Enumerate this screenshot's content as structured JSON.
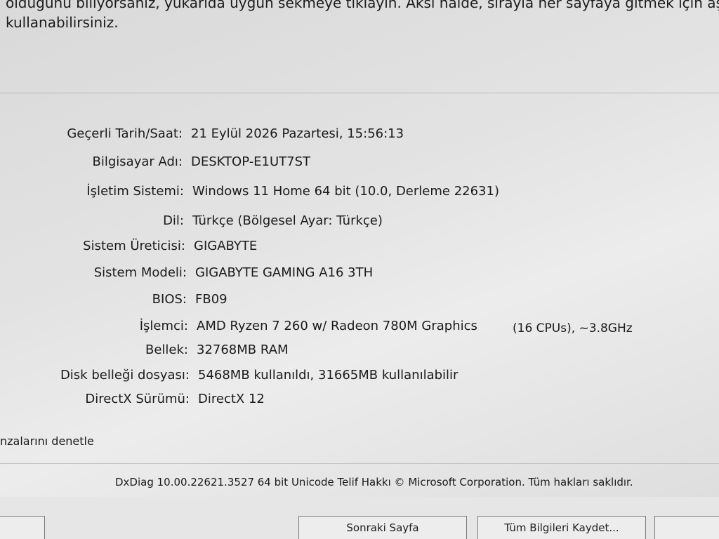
{
  "intro": {
    "line1": "olduğunu biliyorsanız, yukarıda uygun sekmeye tıklayın. Aksi halde, sırayla her sayfaya gitmek için aşağıdaki",
    "line2": "kullanabilirsiniz."
  },
  "system_info": [
    {
      "label": "Geçerli Tarih/Saat:",
      "value": "21 Eylül 2026 Pazartesi, 15:56:13"
    },
    {
      "label": "Bilgisayar Adı:",
      "value": "DESKTOP-E1UT7ST"
    },
    {
      "label": "İşletim Sistemi:",
      "value": "Windows 11 Home 64 bit (10.0, Derleme 22631)"
    },
    {
      "label": "Dil:",
      "value": "Türkçe (Bölgesel Ayar: Türkçe)"
    },
    {
      "label": "Sistem Üreticisi:",
      "value": "GIGABYTE"
    },
    {
      "label": "Sistem Modeli:",
      "value": "GIGABYTE GAMING A16 3TH"
    },
    {
      "label": "BIOS:",
      "value": "FB09"
    },
    {
      "label": "İşlemci:",
      "value": "AMD Ryzen 7 260 w/ Radeon 780M Graphics"
    },
    {
      "label": "Bellek:",
      "value": "32768MB RAM"
    },
    {
      "label": "Disk belleği dosyası:",
      "value": "5468MB kullanıldı, 31665MB kullanılabilir"
    },
    {
      "label": "DirectX Sürümü:",
      "value": "DirectX 12"
    }
  ],
  "cpu_extra": "(16 CPUs), ~3.8GHz",
  "check_link": "nzalarını denetle",
  "footer_version": "DxDiag 10.00.22621.3527 64 bit Unicode  Telif Hakkı © Microsoft Corporation. Tüm hakları saklıdır.",
  "buttons": {
    "next_page": "Sonraki Sayfa",
    "save_all": "Tüm Bilgileri Kaydet..."
  }
}
